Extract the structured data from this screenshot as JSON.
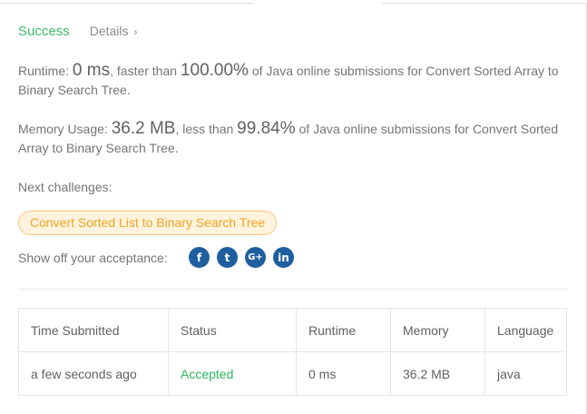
{
  "header": {
    "status": "Success",
    "details_label": "Details",
    "details_chevron": "›"
  },
  "runtime": {
    "prefix": "Runtime: ",
    "value": "0 ms",
    "faster_text": ", faster than ",
    "percentile": "100.00%",
    "suffix": " of Java online submissions for Convert Sorted Array to Binary Search Tree."
  },
  "memory": {
    "prefix": "Memory Usage: ",
    "value": "36.2 MB",
    "less_text": ", less than ",
    "percentile": "99.84%",
    "suffix": " of Java online submissions for Convert Sorted Array to Binary Search Tree."
  },
  "next_challenges": {
    "label": "Next challenges:",
    "items": [
      "Convert Sorted List to Binary Search Tree"
    ]
  },
  "share": {
    "label": "Show off your acceptance:",
    "icons": [
      "facebook-icon",
      "twitter-icon",
      "google-plus-icon",
      "linkedin-icon"
    ],
    "glyphs": {
      "facebook": "f",
      "twitter": "t",
      "gplus": "G+",
      "linkedin": "in"
    }
  },
  "table": {
    "headers": [
      "Time Submitted",
      "Status",
      "Runtime",
      "Memory",
      "Language"
    ],
    "rows": [
      [
        "a few seconds ago",
        "Accepted",
        "0 ms",
        "36.2 MB",
        "java"
      ]
    ]
  },
  "colors": {
    "success": "#2db55d",
    "challenge_text": "#f0a324",
    "challenge_bg": "#fef3dd",
    "social": "#1f5f9f"
  }
}
